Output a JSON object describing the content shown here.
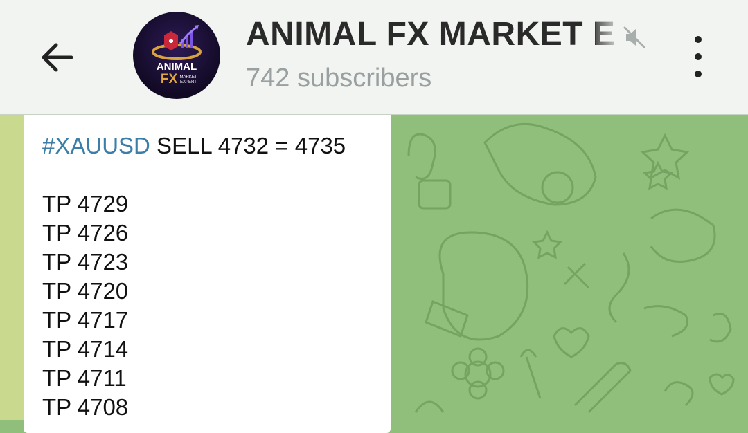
{
  "header": {
    "channel_name": "ANIMAL FX MARKET E",
    "subscribers": "742 subscribers",
    "back_icon": "arrow-left-icon",
    "mute_icon": "muted-speaker-icon",
    "menu_icon": "more-vertical-icon"
  },
  "avatar": {
    "line1": "ANIMAL",
    "line2": "FX",
    "line3": "MARKET",
    "line4": "EXPERT"
  },
  "message": {
    "hashtag": "#XAUUSD",
    "signal": " SELL 4732 = 4735",
    "targets": [
      "TP 4729",
      "TP 4726",
      "TP 4723",
      "TP 4720",
      "TP 4717",
      "TP 4714",
      "TP 4711",
      "TP 4708"
    ]
  },
  "colors": {
    "header_bg": "#f1f4f0",
    "chat_bg": "#8fbf7a",
    "hashtag": "#3c7ea8",
    "subtitle": "#9aa0a0"
  }
}
